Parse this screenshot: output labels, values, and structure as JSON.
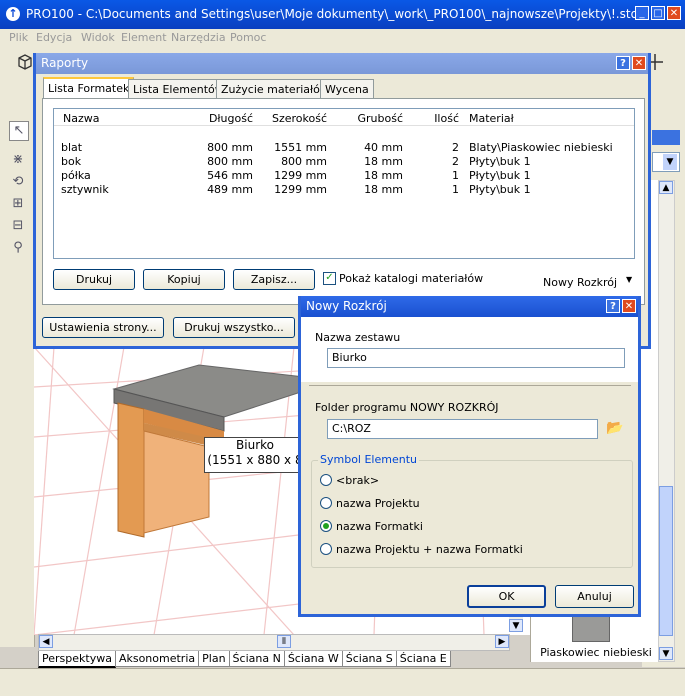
{
  "main_window": {
    "title": "PRO100 - C:\\Documents and Settings\\user\\Moje dokumenty\\_work\\_PRO100\\_najnowsze\\Projekty\\!.sto",
    "app_icon_glyph": "↑",
    "buttons": {
      "minimize": "_",
      "maximize": "□",
      "close": "✕"
    }
  },
  "menu": [
    "Plik",
    "Edycja",
    "Widok",
    "Element",
    "Narzędzia",
    "Pomoc"
  ],
  "viewport": {
    "label_line1": "Biurko",
    "label_line2": "(1551 x 880 x 8"
  },
  "bottom_tabs": [
    "Perspektywa",
    "Aksonometria",
    "Plan",
    "Ściana N",
    "Ściana W",
    "Ściana S",
    "Ściana E"
  ],
  "right_panel": {
    "swatch_label": "Piaskowiec niebieski",
    "swatch_color": "#9a9a98"
  },
  "raporty": {
    "title": "Raporty",
    "tabs": [
      "Lista Formatek",
      "Lista Elementów",
      "Zużycie materiałów",
      "Wycena"
    ],
    "columns": [
      "Nazwa",
      "Długość",
      "Szerokość",
      "Grubość",
      "Ilość",
      "Materiał"
    ],
    "rows": [
      [
        "blat",
        "800 mm",
        "1551 mm",
        "40 mm",
        "2",
        "Blaty\\Piaskowiec niebieski"
      ],
      [
        "bok",
        "800 mm",
        "800 mm",
        "18 mm",
        "2",
        "Płyty\\buk 1"
      ],
      [
        "półka",
        "546 mm",
        "1299 mm",
        "18 mm",
        "1",
        "Płyty\\buk 1"
      ],
      [
        "sztywnik",
        "489 mm",
        "1299 mm",
        "18 mm",
        "1",
        "Płyty\\buk 1"
      ]
    ],
    "btn_print": "Drukuj",
    "btn_copy": "Kopiuj",
    "btn_save": "Zapisz...",
    "checkbox_label": "Pokaż katalogi materiałów",
    "checkbox_checked": true,
    "dropdown_value": "Nowy Rozkrój",
    "btn_page_setup": "Ustawienia strony...",
    "btn_print_all": "Drukuj wszystko..."
  },
  "nowy_rozkroj": {
    "title": "Nowy Rozkrój",
    "set_name_label": "Nazwa zestawu",
    "set_name_value": "Biurko",
    "folder_label": "Folder programu NOWY ROZKRÓJ",
    "folder_value": "C:\\ROZ",
    "symbol_group": "Symbol Elementu",
    "options": [
      "<brak>",
      "nazwa Projektu",
      "nazwa Formatki",
      "nazwa Projektu + nazwa Formatki"
    ],
    "selected_option": 2,
    "btn_ok": "OK",
    "btn_cancel": "Anuluj"
  }
}
